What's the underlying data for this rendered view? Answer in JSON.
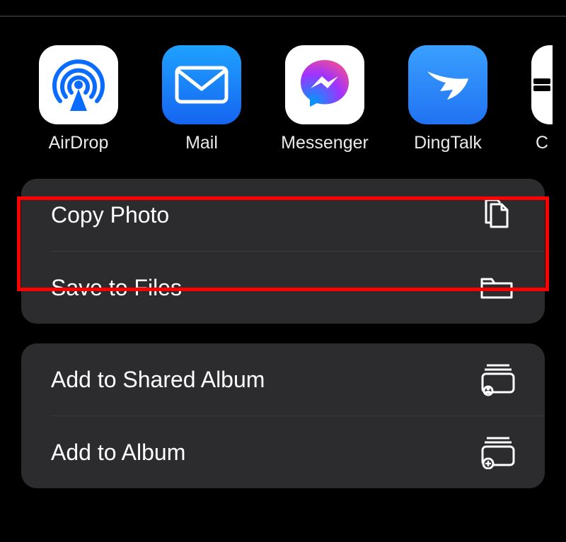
{
  "share_apps": [
    {
      "label": "AirDrop",
      "icon": "airdrop-icon"
    },
    {
      "label": "Mail",
      "icon": "mail-icon"
    },
    {
      "label": "Messenger",
      "icon": "messenger-icon"
    },
    {
      "label": "DingTalk",
      "icon": "dingtalk-icon"
    }
  ],
  "partial_app_label": "C",
  "actions_group1": [
    {
      "label": "Copy Photo",
      "icon": "copy-icon"
    },
    {
      "label": "Save to Files",
      "icon": "folder-icon"
    }
  ],
  "actions_group2": [
    {
      "label": "Add to Shared Album",
      "icon": "shared-album-icon"
    },
    {
      "label": "Add to Album",
      "icon": "add-album-icon"
    }
  ]
}
